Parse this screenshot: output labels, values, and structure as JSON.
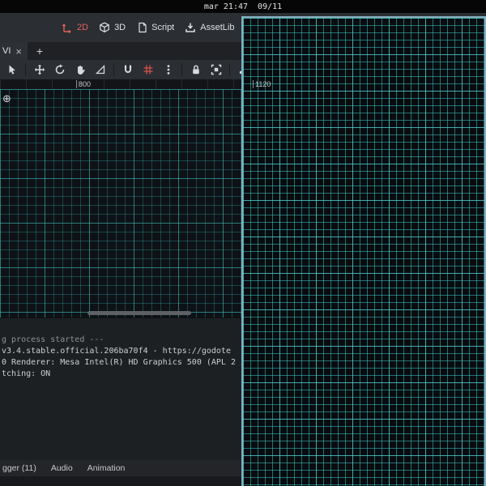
{
  "system_bar": {
    "clock_text": "mar 21:47  09/11"
  },
  "workspace": {
    "buttons": [
      {
        "label": "2D",
        "icon": "2d-axes-icon",
        "active": true
      },
      {
        "label": "3D",
        "icon": "3d-cube-icon",
        "active": false
      },
      {
        "label": "Script",
        "icon": "script-icon",
        "active": false
      },
      {
        "label": "AssetLib",
        "icon": "assetlib-download-icon",
        "active": false
      }
    ]
  },
  "scene_tabs": {
    "active_label": "VI",
    "close_glyph": "×",
    "new_tab_glyph": "+"
  },
  "canvas_toolbar": {
    "tools": [
      "select-tool",
      "move-tool",
      "rotate-tool",
      "pan-tool",
      "ruler-tool",
      "smart-snap-toggle",
      "grid-snap-toggle",
      "snap-options-menu",
      "lock-object",
      "group-object",
      "skeleton-options"
    ]
  },
  "ruler": {
    "labels": [
      {
        "text": "800"
      },
      {
        "text": "1120"
      }
    ]
  },
  "viewport": {
    "origin_glyph": "⊕"
  },
  "output_panel": {
    "lines": [
      {
        "text": "g process started ---"
      },
      {
        "text": "v3.4.stable.official.206ba70f4 - https://godote"
      },
      {
        "text": "0 Renderer: Mesa Intel(R) HD Graphics 500 (APL 2"
      },
      {
        "text": "tching: ON"
      }
    ]
  },
  "bottom_tabs": [
    {
      "label": "gger (11)"
    },
    {
      "label": "Audio"
    },
    {
      "label": "Animation"
    }
  ],
  "colors": {
    "accent_red": "#e0635c",
    "editor_grid_line": "#38bab6",
    "game_grid_line": "#42d4d4",
    "game_window_border": "#87aebf",
    "viewport_background": "#0e1216"
  }
}
